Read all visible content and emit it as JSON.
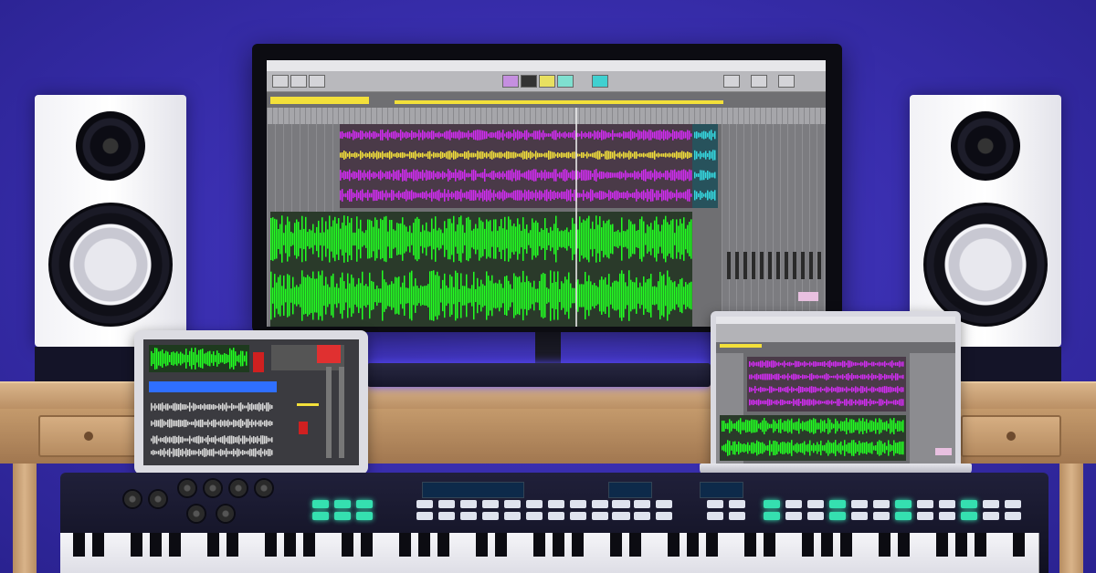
{
  "scene": {
    "description_type": "music-production-studio-photo",
    "colors": {
      "wall": "#3a2fb0",
      "desk": "#c49a6c",
      "waveform_green": "#22ff22",
      "waveform_magenta": "#d02cf0",
      "waveform_yellow": "#f3e03a",
      "waveform_cyan": "#36d8e0",
      "pad_teal": "#35e0b0",
      "accent_blue": "#2f6fff"
    }
  },
  "objects": {
    "left_speaker": {
      "icon": "studio-monitor-speaker"
    },
    "right_speaker": {
      "icon": "studio-monitor-speaker"
    },
    "monitor": {
      "icon": "daw-screen"
    },
    "tablet": {
      "icon": "tablet-daw"
    },
    "laptop": {
      "icon": "laptop-daw"
    },
    "midi_keyboard": {
      "icon": "midi-controller"
    }
  }
}
